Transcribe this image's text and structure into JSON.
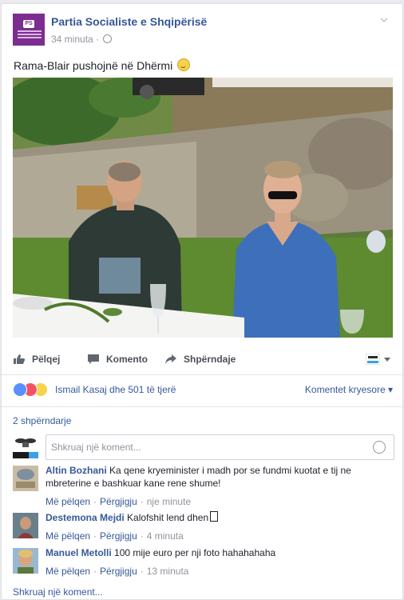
{
  "post": {
    "page_name": "Partia Socialiste e Shqipërisë",
    "time": "34 minuta",
    "separator": "·",
    "text": "Rama-Blair pushojnë në Dhërmi"
  },
  "actions": {
    "like": "Pëlqej",
    "comment": "Komento",
    "share": "Shpërndaje"
  },
  "reactions": {
    "summary": "Ismail Kasaj dhe 501 të tjerë",
    "top_comments": "Komentet kryesore",
    "icons": [
      "like-icon",
      "love-icon",
      "haha-icon"
    ]
  },
  "shares": "2 shpërndarje",
  "composer": {
    "placeholder": "Shkruaj një koment..."
  },
  "comments": [
    {
      "author": "Altin Bozhani",
      "text": "Ka qene kryeminister i madh por se fundmi kuotat e tij ne mbreterine e bashkuar kane rene shume!",
      "like": "Më pëlqen",
      "reply": "Përgjigju",
      "time": "nje minute"
    },
    {
      "author": "Destemona Mejdi",
      "text": "Kalofshit lend dhen",
      "like": "Më pëlqen",
      "reply": "Përgjigju",
      "time": "4 minuta"
    },
    {
      "author": "Manuel Metolli",
      "text": "100 mije euro per nji foto hahahahaha",
      "like": "Më pëlqen",
      "reply": "Përgjigju",
      "time": "13 minuta"
    }
  ],
  "write_comment": "Shkruaj një koment...",
  "colors": {
    "link": "#365899",
    "meta": "#90949c",
    "page_avatar": "#7b2e8f",
    "like_blue": "#5890ff",
    "love_red": "#f25268",
    "haha_yellow": "#f7d24a"
  }
}
